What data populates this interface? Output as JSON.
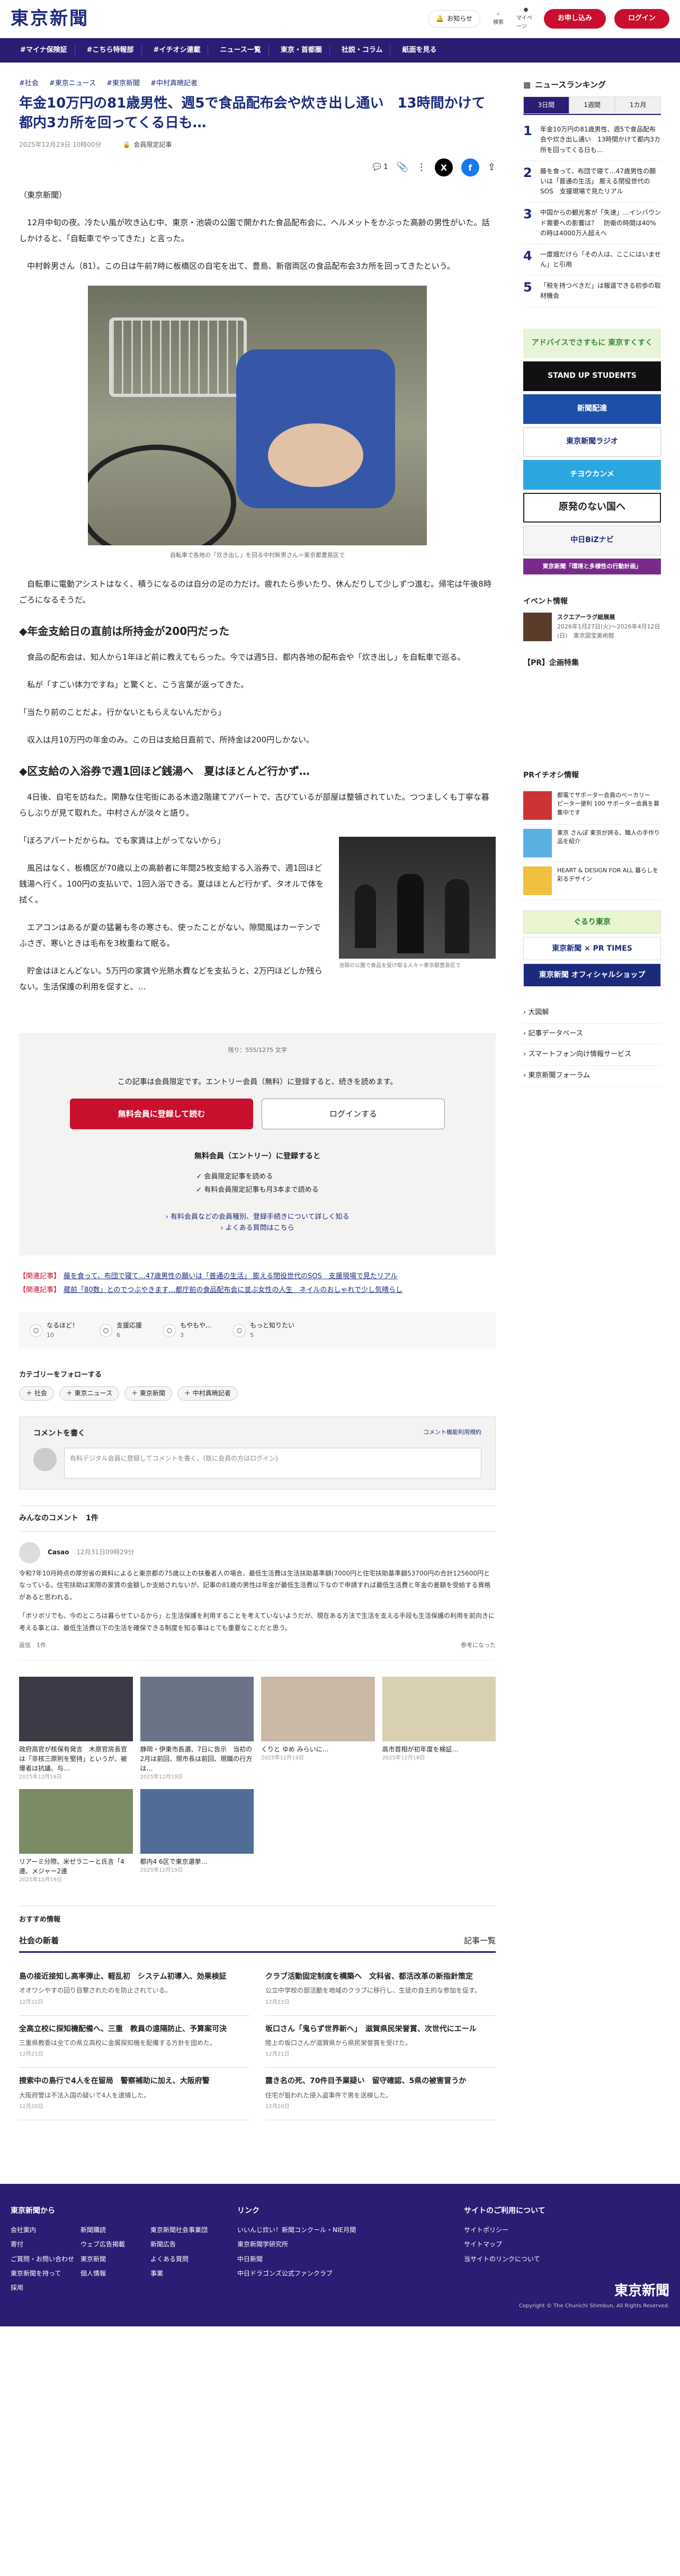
{
  "header": {
    "logo": "東京新聞",
    "notify": "お知らせ",
    "search": "検索",
    "mypage": "マイページ",
    "trial": "お申し込み",
    "login": "ログイン"
  },
  "nav": [
    "#マイナ保険証",
    "#こちら特報部",
    "#イチオシ連載",
    "ニュース一覧",
    "東京・首都圏",
    "社説・コラム",
    "紙面を見る"
  ],
  "article": {
    "tags": [
      "#社会",
      "#東京ニュース",
      "#東京新聞",
      "#中村真暁記者"
    ],
    "title": "年金10万円の81歳男性、週5で食品配布会や炊き出し通い　13時間かけて都内3カ所を回ってくる日も…",
    "date": "2025年12月29日 10時00分",
    "member": "会員限定記事",
    "share_count": "1",
    "p1": "（東京新聞）",
    "p2": "　12月中旬の夜。冷たい風が吹き込む中、東京・池袋の公園で開かれた食品配布会に、ヘルメットをかぶった高齢の男性がいた。話しかけると、「自転車でやってきた」と言った。",
    "p3": "　中村幹男さん（81）。この日は午前7時に板橋区の自宅を出て、豊島、新宿両区の食品配布会3カ所を回ってきたという。",
    "photo_caption": "自転車で各地の「炊き出し」を回る中村幹男さん＝東京都豊島区で",
    "p4": "　自転車に電動アシストはなく、積うになるのは自分の足の力だけ。疲れたら歩いたり、休んだりして少しずつ進む。帰宅は午後8時ごろになるそうだ。",
    "h2a": "◆年金支給日の直前は所持金が200円だった",
    "p5": "　食品の配布会は、知人から1年ほど前に教えてもらった。今では週5日、都内各地の配布会や「炊き出し」を自転車で巡る。",
    "p6": "　私が「すごい体力ですね」と驚くと、こう言葉が返ってきた。",
    "p7": "「当たり前のことだよ。行かないともらえないんだから」",
    "p8": "　収入は月10万円の年金のみ。この日は支給日直前で、所持金は200円しかない。",
    "h2b": "◆区支給の入浴券で週1回ほど銭湯へ　夏はほとんど行かず…",
    "p9": "　4日後、自宅を訪ねた。閑静な住宅街にある木造2階建てアパートで、古びているが部屋は整頓されていた。つつましくも丁寧な暮らしぶりが見て取れた。中村さんが淡々と語り。",
    "p10": "「ぼろアパートだからね。でも家賃は上がってないから」",
    "p11": "　風呂はなく、板橋区が70歳以上の高齢者に年間25枚支給する入浴券で、週1回ほど銭湯へ行く。100円の支払いで、1回入浴できる。夏はほとんど行かず、タオルで体を拭く。",
    "p12": "　エアコンはあるが夏の猛暑も冬の寒さも、使ったことがない。隙間風はカーテンでふさぎ、寒いときは毛布を3枚重ねて眠る。",
    "p13": "　貯金はほとんどない。5万円の家賃や光熱水費などを支払うと、2万円ほどしか残らない。生活保護の利用を促すと、…",
    "photo2_caption": "池袋の公園で食品を受け取る人々＝東京都豊島区で"
  },
  "paywall": {
    "count": "残り：555/1275 文字",
    "msg": "この記事は会員限定です。エントリー会員（無料）に登録すると、続きを読めます。",
    "btn_free": "無料会員に登録して読む",
    "btn_login": "ログインする",
    "sub": "無料会員（エントリー）に登録すると",
    "benefit1": "会員限定記事を読める",
    "benefit2": "有料会員限定記事も月3本まで読める",
    "link1": "有料会員などの会員種別、登録手続きについて詳しく知る",
    "link2": "よくある質問はこちら"
  },
  "related": [
    {
      "label": "【関連記事】",
      "text": "藤を食って、布団で寝て…47歳男性の願いは「普通の生活」 膨える閉役世代のSOS　支援現場で見たリアル"
    },
    {
      "label": "【関連記事】",
      "text": "蔵前「80数」とのでつぶやきます…都庁前の食品配布会に並ぶ女性の人生　ネイルのおしゃれで少し気晴らし"
    }
  ],
  "reactions": [
    {
      "icon": "○",
      "label": "なるほど！",
      "count": "10"
    },
    {
      "icon": "○",
      "label": "支援応援",
      "count": "6"
    },
    {
      "icon": "○",
      "label": "もやもや…",
      "count": "3"
    },
    {
      "icon": "○",
      "label": "もっと知りたい",
      "count": "5"
    }
  ],
  "follow": {
    "title": "カテゴリーをフォローする",
    "tags": [
      "社会",
      "東京ニュース",
      "東京新聞",
      "中村真暁記者"
    ]
  },
  "comment": {
    "title": "コメントを書く",
    "guide": "コメント機能利用規約",
    "placeholder": "有料デジタル会員に登録してコメントを書く。(既に会員の方はログイン)",
    "list_title": "みんなのコメント　1件",
    "user": "Casao",
    "date": "12月31日09時29分",
    "text": "令和7年10月時点の厚労省の資料によると東京都の75歳以上の扶養者人の場合、最低生活費は生活扶助基準額(7000円と住宅扶助基準額53700円の合計125600円となっている。住宅扶助は実際の家賃の金額しか支給されないが、記事の81歳の男性は年金が最低生活費以下なので申請すれば最低生活費と年金の差額を受給する資格があると思われる。",
    "text2": "「ボリボリでも、今のところは暮らせているから」と生活保護を利用することを考えていないようだが、現在ある方法で生活を支える手段も生活保護の利用を前向きに考える事とは、最低生活費以下の生活を確保できる制度を知る事はとても重要なことだと思う。",
    "reply": "返信　1件",
    "helpful": "参考になった"
  },
  "cards": [
    {
      "title": "政府高官が核保有発言　木原官房長官は「非核三原則を堅持」というが、被爆者は抗議、与…",
      "date": "2025年12月19日"
    },
    {
      "title": "静岡・伊東市長選、7日に告示　当初の2月は前回、現市長は前回、現職の行方は…",
      "date": "2025年12月19日"
    },
    {
      "title": "くりと ゆめ みらいに…",
      "date": "2025年12月19日"
    },
    {
      "title": "高市首相が初年度を検証…",
      "date": "2025年12月18日"
    },
    {
      "title": "リアーミ分際、米ゼラニーと氏言「4連、メジャー2連",
      "date": "2025年12月19日"
    },
    {
      "title": "都内4 6区で東京選挙…",
      "date": "2025年12月19日"
    }
  ],
  "reco": "おすすめ情報",
  "social": {
    "title": "社会の新着",
    "more": "記事一覧",
    "items": [
      {
        "title": "島の接近接知し高率弾止、軽乱初　システム初導入、効果検証",
        "body": "オオワシやすの回り目撃されたのを防止されている。",
        "date": "12月22日"
      },
      {
        "title": "クラブ活動固定制度を構築へ　文科省、都活改革の新指針策定",
        "body": "公立中学校の部活動を地域のクラブに移行し、生徒の自主的な参加を促す。",
        "date": "12月22日"
      },
      {
        "title": "全高立校に探知機配備へ、三重　教員の遠隔防止、予算案可決",
        "body": "三重県教委は全ての県立高校に金属探知機を配備する方針を固めた。",
        "date": "12月21日"
      },
      {
        "title": "坂口さん「鬼らず世界新へ」　滋賀県民栄誉賞、次世代にエール",
        "body": "陸上の坂口さんが滋賀県から県民栄誉賞を受けた。",
        "date": "12月21日"
      },
      {
        "title": "捜索中の島行で4人を在留局　警察補助に加え、大阪府警",
        "body": "大阪府警は不法入国の疑いで4人を逮捕した。",
        "date": "12月20日"
      },
      {
        "title": "露き名の死、70件目予業疑い　留守確認、5県の被害冒うか",
        "body": "住宅が狙われた侵入盗事件で男を送検した。",
        "date": "12月20日"
      }
    ]
  },
  "side": {
    "ranking_title": "ニュースランキング",
    "tabs": [
      "3日間",
      "1週間",
      "1カ月"
    ],
    "ranks": [
      {
        "n": "1",
        "t": "年金10万円の81歳男性、週5で食品配布会や炊き出し通い　13時間かけて都内3カ所を回ってくる日も…"
      },
      {
        "n": "2",
        "t": "藤を食って、布団で寝て…47歳男性の願いは「普通の生活」 膨える閉役世代のSOS　支援現場で見たリアル"
      },
      {
        "n": "3",
        "t": "中国からの観光客が「失速」…インバウンド需要への影響は？　防衛の時間は40%の時は4000万人超えへ"
      },
      {
        "n": "4",
        "t": "一度畑だけら「その人は、ここにはいません」と引用"
      },
      {
        "n": "5",
        "t": "「税を持つべきだ」は報道できる初歩の取材機会"
      }
    ],
    "banners": [
      "アドバイスでさすもに 東京すくすく",
      "STAND UP STUDENTS",
      "新聞配達",
      "東京新聞ラジオ",
      "チヨウカンメ",
      "原発のない国へ",
      "中日BiZナビ",
      "東京新聞「環境と多様性の行動計画」"
    ],
    "event_title": "イベント情報",
    "event_name": "スクエアーラグ総展展",
    "event_date": "2026年1月27日(火)～2026年4月12日(日)　東京国宝美術館",
    "pr_title": "【PR】企画特集",
    "pr_pick": "PRイチオシ情報",
    "pr_items": [
      "都電でサポーター会員のベーカリー　ピーター便利 100 サポーター会員を募集中です",
      "東京 さんぽ 東京が誇る、職人の手作り品を紹介",
      "HEART & DESIGN FOR ALL 暮らしを彩るデザイン"
    ],
    "pr_banners": [
      "ぐるり東京",
      "東京新聞 × PR TIMES",
      "東京新聞 オフィシャルショップ"
    ],
    "links": [
      "大図解",
      "記事データベース",
      "スマートフォン向け情報サービス",
      "東京新聞フォーラム"
    ]
  },
  "footer": {
    "col1_title": "東京新聞から",
    "col1": [
      "会社案内",
      "新聞購読",
      "東京新聞社会事業団",
      "寄付",
      "ウェブ広告掲載",
      "新聞広告",
      "ご質問・お問い合わせ",
      "東京新聞",
      "よくある質問",
      "東京新聞を持って",
      "個人情報",
      "事業",
      "採用"
    ],
    "col2_title": "リンク",
    "col2": [
      "いいんじ炊い！新聞コンクール・NIE月間",
      "東京新聞学研究所",
      "中日新聞",
      "中日ドラゴンズ公式ファンクラブ"
    ],
    "col3_title": "サイトのご利用について",
    "col3": [
      "サイトポリシー",
      "サイトマップ",
      "当サイトのリンクについて"
    ],
    "logo": "東京新聞",
    "copy": "Copyright © The Chunichi Shimbun, All Rights Reserved."
  }
}
